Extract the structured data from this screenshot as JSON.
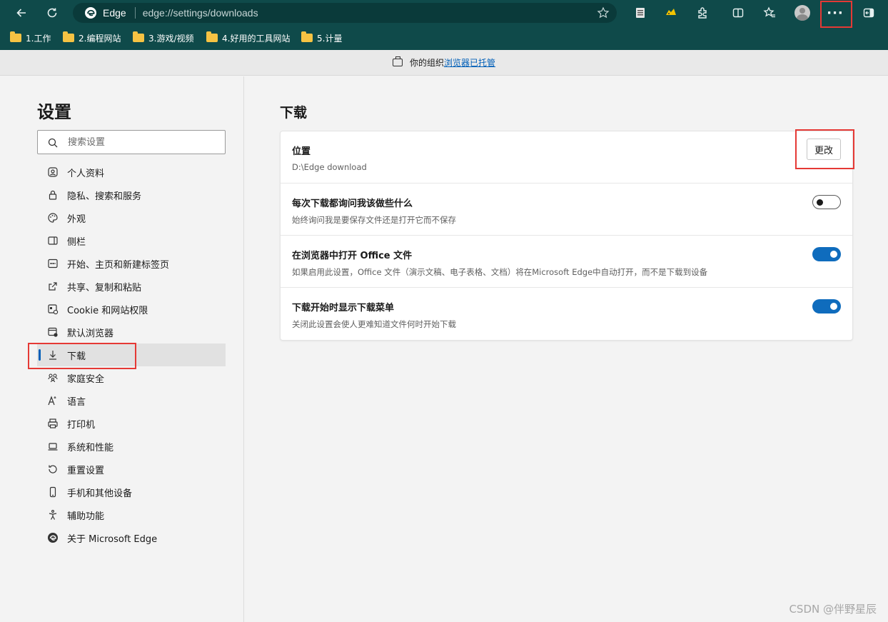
{
  "browser": {
    "brand": "Edge",
    "url": "edge://settings/downloads"
  },
  "bookmarks": [
    {
      "label": "1.工作"
    },
    {
      "label": "2.编程网站"
    },
    {
      "label": "3.游戏/视频"
    },
    {
      "label": "4.好用的工具网站"
    },
    {
      "label": "5.计量"
    }
  ],
  "infobar": {
    "text": "你的组织",
    "link": "浏览器已托管"
  },
  "sidebar": {
    "title": "设置",
    "search_placeholder": "搜索设置",
    "items": [
      {
        "label": "个人资料",
        "icon": "profile-icon"
      },
      {
        "label": "隐私、搜索和服务",
        "icon": "lock-icon"
      },
      {
        "label": "外观",
        "icon": "palette-icon"
      },
      {
        "label": "侧栏",
        "icon": "sidebar-icon"
      },
      {
        "label": "开始、主页和新建标签页",
        "icon": "home-icon"
      },
      {
        "label": "共享、复制和粘贴",
        "icon": "share-icon"
      },
      {
        "label": "Cookie 和网站权限",
        "icon": "cookie-icon"
      },
      {
        "label": "默认浏览器",
        "icon": "browser-icon"
      },
      {
        "label": "下载",
        "icon": "download-icon",
        "active": true
      },
      {
        "label": "家庭安全",
        "icon": "family-icon"
      },
      {
        "label": "语言",
        "icon": "language-icon"
      },
      {
        "label": "打印机",
        "icon": "printer-icon"
      },
      {
        "label": "系统和性能",
        "icon": "laptop-icon"
      },
      {
        "label": "重置设置",
        "icon": "reset-icon"
      },
      {
        "label": "手机和其他设备",
        "icon": "phone-icon"
      },
      {
        "label": "辅助功能",
        "icon": "accessibility-icon"
      },
      {
        "label": "关于 Microsoft Edge",
        "icon": "edge-icon"
      }
    ]
  },
  "main": {
    "title": "下载",
    "location": {
      "title": "位置",
      "path": "D:\\Edge download",
      "button": "更改"
    },
    "settings": [
      {
        "title": "每次下载都询问我该做些什么",
        "desc": "始终询问我是要保存文件还是打开它而不保存",
        "enabled": false
      },
      {
        "title": "在浏览器中打开 Office 文件",
        "desc": "如果启用此设置，Office 文件（演示文稿、电子表格、文档）将在Microsoft Edge中自动打开，而不是下载到设备",
        "enabled": true
      },
      {
        "title": "下载开始时显示下载菜单",
        "desc": "关闭此设置会使人更难知道文件何时开始下载",
        "enabled": true
      }
    ]
  },
  "watermark": "CSDN @伴野星辰",
  "colors": {
    "toolbar": "#0f4a4a",
    "accent": "#0f6cbd",
    "highlight": "#e53935"
  }
}
